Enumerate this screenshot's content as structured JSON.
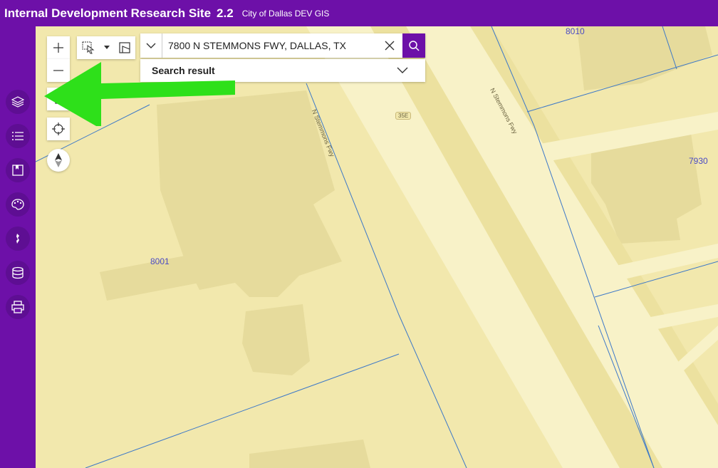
{
  "header": {
    "title": "Internal Development Research Site",
    "version": "2.2",
    "subtitle": "City of Dallas DEV GIS"
  },
  "sidebar": {
    "items": [
      {
        "name": "layers-icon"
      },
      {
        "name": "legend-list-icon"
      },
      {
        "name": "bookmark-icon"
      },
      {
        "name": "basemap-palette-icon"
      },
      {
        "name": "measure-icon"
      },
      {
        "name": "database-icon"
      },
      {
        "name": "print-icon"
      }
    ]
  },
  "search": {
    "value": "7800 N STEMMONS FWY, DALLAS, TX",
    "result_label": "Search result"
  },
  "map": {
    "parcel_labels": [
      "8010",
      "7930",
      "8001"
    ],
    "street_labels": [
      "N Stemmons Fwy",
      "N Stemmons Fwy"
    ],
    "shield": "35E"
  },
  "colors": {
    "header": "#6d10a8",
    "map_background": "#f2e8ad",
    "annotation_arrow": "#2ee01a",
    "parcel_lines": "#3c78c8"
  }
}
